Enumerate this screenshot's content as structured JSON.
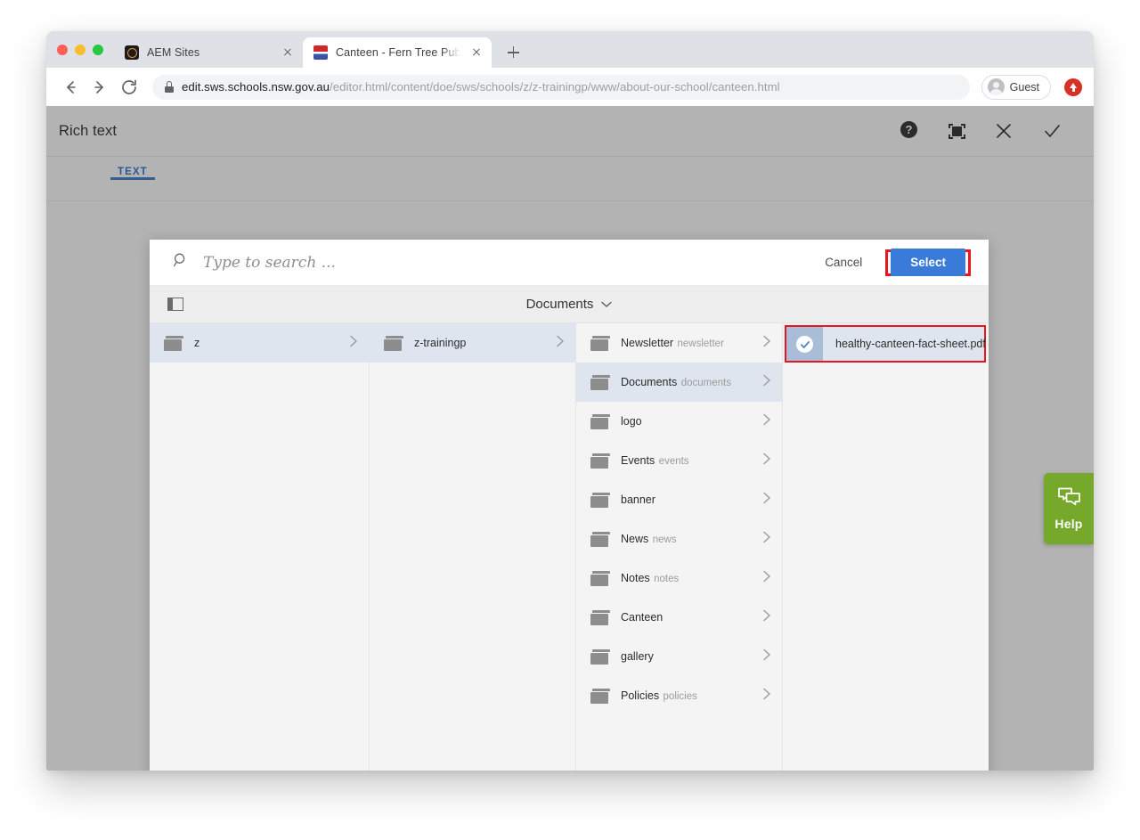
{
  "browser": {
    "tabs": [
      {
        "title": "AEM Sites",
        "favicon": "aem-favicon",
        "active": false
      },
      {
        "title": "Canteen - Fern Tree Public Sch",
        "favicon": "school-favicon",
        "active": true
      }
    ],
    "new_tab_label": "+",
    "url": {
      "host": "edit.sws.schools.nsw.gov.au",
      "path": "/editor.html/content/doe/sws/schools/z/z-trainingp/www/about-our-school/canteen.html",
      "lock_icon": "lock-icon"
    },
    "profile_label": "Guest",
    "extension_icon": "red-upload-icon"
  },
  "aem": {
    "title": "Rich text",
    "header_icons": [
      "help-icon",
      "fullscreen-icon",
      "close-icon",
      "confirm-icon"
    ],
    "tabs": [
      {
        "label": "TEXT",
        "active": true
      }
    ]
  },
  "picker": {
    "search_placeholder": "Type to search ...",
    "search_value": "",
    "cancel_label": "Cancel",
    "select_label": "Select",
    "select_highlight_color": "#e8171f",
    "select_button_color": "#3a7ad9",
    "breadcrumb_label": "Documents",
    "rail_toggle_icon": "panel-toggle-icon",
    "columns": [
      {
        "id": "col-1",
        "items": [
          {
            "title": "z",
            "subtitle": "",
            "selected": true,
            "has_chevron": true
          }
        ]
      },
      {
        "id": "col-2",
        "items": [
          {
            "title": "z-trainingp",
            "subtitle": "",
            "selected": true,
            "has_chevron": true
          }
        ]
      },
      {
        "id": "col-3",
        "items": [
          {
            "title": "Newsletter",
            "subtitle": "newsletter",
            "selected": false,
            "has_chevron": true
          },
          {
            "title": "Documents",
            "subtitle": "documents",
            "selected": true,
            "has_chevron": true
          },
          {
            "title": "logo",
            "subtitle": "",
            "selected": false,
            "has_chevron": true
          },
          {
            "title": "Events",
            "subtitle": "events",
            "selected": false,
            "has_chevron": true
          },
          {
            "title": "banner",
            "subtitle": "",
            "selected": false,
            "has_chevron": true
          },
          {
            "title": "News",
            "subtitle": "news",
            "selected": false,
            "has_chevron": true
          },
          {
            "title": "Notes",
            "subtitle": "notes",
            "selected": false,
            "has_chevron": true
          },
          {
            "title": "Canteen",
            "subtitle": "",
            "selected": false,
            "has_chevron": true
          },
          {
            "title": "gallery",
            "subtitle": "",
            "selected": false,
            "has_chevron": true
          },
          {
            "title": "Policies",
            "subtitle": "policies",
            "selected": false,
            "has_chevron": true
          }
        ]
      },
      {
        "id": "col-4",
        "asset": {
          "name": "healthy-canteen-fact-sheet.pdf",
          "selected": true,
          "highlight_color": "#e8171f"
        }
      }
    ]
  },
  "help_widget": {
    "label": "Help",
    "icon": "chat-bubbles-icon",
    "color": "#76a82c"
  }
}
